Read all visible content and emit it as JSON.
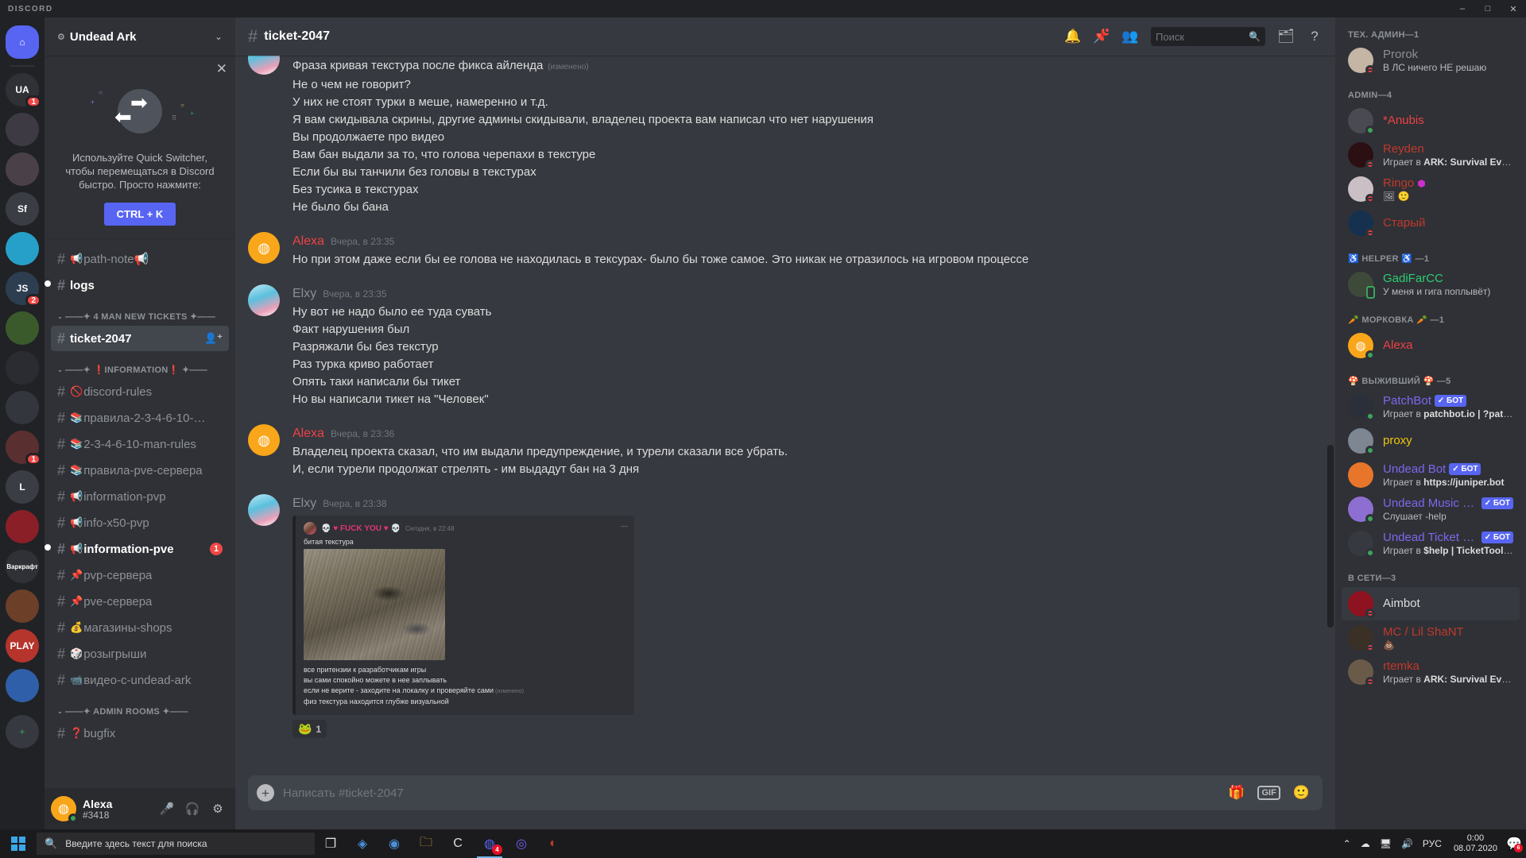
{
  "window": {
    "app_name": "DISCORD",
    "minimize": "–",
    "maximize": "□",
    "close": "✕"
  },
  "guild_rail": {
    "home_label": "⌂",
    "add_label": "+",
    "servers": [
      {
        "name": "UA",
        "badge": "1",
        "color": "#2f3136"
      },
      {
        "name": "",
        "badge": "",
        "color": "#3d3a44"
      },
      {
        "name": "",
        "badge": "",
        "color": "#4a4148"
      },
      {
        "name": "Sf",
        "badge": "",
        "color": "#3a3d44"
      },
      {
        "name": "",
        "badge": "",
        "color": "#27a0c9"
      },
      {
        "name": "JS",
        "badge": "2",
        "color": "#2c3e50"
      },
      {
        "name": "",
        "badge": "",
        "color": "#3a5a2c"
      },
      {
        "name": "",
        "badge": "",
        "color": "#2a2c31"
      },
      {
        "name": "",
        "badge": "",
        "color": "#33363c"
      },
      {
        "name": "",
        "badge": "1",
        "color": "#5a2f30"
      },
      {
        "name": "L",
        "badge": "",
        "color": "#3a3d44"
      },
      {
        "name": "",
        "badge": "",
        "color": "#8a1f28"
      },
      {
        "name": "Варкрафт",
        "badge": "",
        "color": "#2f3136"
      },
      {
        "name": "",
        "badge": "",
        "color": "#6b3f28"
      },
      {
        "name": "PLAY",
        "badge": "",
        "color": "#b5342c"
      },
      {
        "name": "",
        "badge": "",
        "color": "#2f5fa8"
      }
    ]
  },
  "sidebar": {
    "guild_name": "Undead Ark",
    "guild_icon": "gear-icon",
    "chevron": "⌄",
    "promo": {
      "close": "✕",
      "text": "Используйте Quick Switcher, чтобы перемещаться в Discord быстро. Просто нажмите:",
      "shortcut": "CTRL + K"
    },
    "groups": [
      {
        "label": "",
        "channels": [
          {
            "emoji": "📢",
            "name": "path-note📢",
            "state": "normal",
            "pill": false
          },
          {
            "emoji": "",
            "name": "logs",
            "state": "unread",
            "pill": true
          }
        ]
      },
      {
        "label": "——✦ 4 MAN NEW TICKETS ✦——",
        "channels": [
          {
            "emoji": "",
            "name": "ticket-2047",
            "state": "active",
            "pill": false,
            "locked": true,
            "add_member": true
          }
        ]
      },
      {
        "label": "——✦ ❗INFORMATION❗ ✦——",
        "channels": [
          {
            "emoji": "🚫",
            "name": "discord-rules",
            "state": "normal",
            "pill": false
          },
          {
            "emoji": "📚",
            "name": "правила-2-3-4-6-10-…",
            "state": "normal",
            "pill": false
          },
          {
            "emoji": "📚",
            "name": "2-3-4-6-10-man-rules",
            "state": "normal",
            "pill": false
          },
          {
            "emoji": "📚",
            "name": "правила-pve-сервера",
            "state": "normal",
            "pill": false
          },
          {
            "emoji": "📢",
            "name": "information-pvp",
            "state": "normal",
            "pill": false
          },
          {
            "emoji": "📢",
            "name": "info-x50-pvp",
            "state": "normal",
            "pill": false
          },
          {
            "emoji": "📢",
            "name": "information-pve",
            "state": "unread",
            "pill": true,
            "badge": "1"
          },
          {
            "emoji": "📌",
            "name": "pvp-сервера",
            "state": "normal",
            "pill": false
          },
          {
            "emoji": "📌",
            "name": "pve-сервера",
            "state": "normal",
            "pill": false
          },
          {
            "emoji": "💰",
            "name": "магазины-shops",
            "state": "normal",
            "pill": false
          },
          {
            "emoji": "🎲",
            "name": "розыгрыши",
            "state": "normal",
            "pill": false
          },
          {
            "emoji": "📹",
            "name": "видео-c-undead-ark",
            "state": "normal",
            "pill": false
          }
        ]
      },
      {
        "label": "——✦ ADMIN ROOMS ✦——",
        "channels": [
          {
            "emoji": "❓",
            "name": "bugfix",
            "state": "normal",
            "pill": false
          }
        ]
      }
    ],
    "user": {
      "name": "Alexa",
      "tag": "#3418",
      "mic_icon": "microphone-icon",
      "headset_icon": "headset-icon",
      "settings_icon": "gear-icon"
    }
  },
  "channel_header": {
    "hash": "#",
    "title": "ticket-2047",
    "icons": [
      "bell-icon",
      "pin-icon",
      "members-icon",
      "inbox-icon",
      "help-icon"
    ],
    "search_placeholder": "Поиск"
  },
  "messages": [
    {
      "type": "continuation",
      "avatar_color": "#5bc0de",
      "lines": [
        {
          "text": "Фраза кривая текстура после фикса айленда",
          "edited": "(изменено)"
        },
        {
          "text": "Не о чем не говорит?"
        },
        {
          "text": "У них не стоят турки в меше, намеренно  и т.д."
        },
        {
          "text": "Я вам скидывала скрины, другие админы скидывали, владелец проекта вам написал что нет нарушения"
        },
        {
          "text": "Вы продолжаете про видео"
        },
        {
          "text": "Вам бан выдали за то, что голова черепахи в текстуре"
        },
        {
          "text": "Если бы вы танчили без головы в текстурах"
        },
        {
          "text": "Без тусика в текстурах"
        },
        {
          "text": "Не было бы бана"
        }
      ]
    },
    {
      "type": "message",
      "author": "Alexa",
      "author_color": "#ed4245",
      "timestamp": "Вчера, в 23:35",
      "avatar_type": "discord-orange",
      "lines": [
        {
          "text": "Но при этом даже если бы ее голова не находилась в тексурах- было бы тоже самое. Это никак не отразилось на игровом процессе"
        }
      ]
    },
    {
      "type": "message",
      "author": "Elxy",
      "author_color": "#8b8f95",
      "timestamp": "Вчера, в 23:35",
      "avatar_color": "#5bc0de",
      "lines": [
        {
          "text": "Ну вот не надо было ее туда сувать"
        },
        {
          "text": "Факт нарушения был"
        },
        {
          "text": "Разряжали бы  без текстур"
        },
        {
          "text": "Раз турка криво работает"
        },
        {
          "text": "Опять таки написали бы тикет"
        },
        {
          "text": "Но вы написали тикет на \"Человек\""
        }
      ]
    },
    {
      "type": "message",
      "author": "Alexa",
      "author_color": "#ed4245",
      "timestamp": "Вчера, в 23:36",
      "avatar_type": "discord-orange",
      "lines": [
        {
          "text": "Владелец проекта сказал, что им выдали предупреждение, и турели сказали все убрать."
        },
        {
          "text": "И, если турели продолжат стрелять - им выдадут бан на 3 дня"
        }
      ]
    },
    {
      "type": "message",
      "author": "Elxy",
      "author_color": "#8b8f95",
      "timestamp": "Вчера, в 23:38",
      "avatar_color": "#5bc0de",
      "embed": {
        "author": "💀 ♥ FUCK YOU ♥ 💀",
        "timestamp": "Сегодня, в 22:48",
        "caption": "битая текстура",
        "lines": [
          {
            "text": "все притензии к разработчикам игры"
          },
          {
            "text": "вы сами спокойно можете в нее заплывать"
          },
          {
            "text": "если не верите - заходите на локалку и проверяйте сами",
            "edited": "(изменено)"
          },
          {
            "text": "физ текстура находится глубже визуальной"
          }
        ]
      },
      "reactions": [
        {
          "emoji": "🐸",
          "count": "1"
        }
      ]
    }
  ],
  "composer": {
    "placeholder": "Написать #ticket-2047",
    "plus": "+",
    "gift_icon": "gift-icon",
    "gif_label": "GIF",
    "emoji_icon": "emoji-icon"
  },
  "member_list": {
    "groups": [
      {
        "label": "ТЕХ. АДМИН—1",
        "members": [
          {
            "name": "Prorok",
            "color": "#8b8f95",
            "status": "dnd",
            "sub": "В ЛС ничего НЕ решаю",
            "avatar_color": "#c4b5a5"
          }
        ]
      },
      {
        "label": "ADMIN—4",
        "members": [
          {
            "name": "*Anubis",
            "color": "#ed4245",
            "status": "online",
            "sub": "",
            "avatar_color": "#4a4a52"
          },
          {
            "name": "Reyden",
            "color": "#c0392b",
            "status": "dnd",
            "sub": "Играет в ARK: Survival Evolved",
            "sub_bold": "ARK: Survival Evolved",
            "avatar_color": "#2b0f12"
          },
          {
            "name": "Ringo",
            "color": "#c0392b",
            "status": "dnd",
            "sub": "🖼 🙂",
            "avatar_color": "#c9bfc4",
            "name_suffix": "⬢"
          },
          {
            "name": "Старый",
            "color": "#c0392b",
            "status": "dnd",
            "sub": "",
            "avatar_color": "#15314f"
          }
        ]
      },
      {
        "label": "♿ HELPER ♿ —1",
        "members": [
          {
            "name": "GadiFarCC",
            "color": "#2ecc71",
            "status": "mobile",
            "sub": "У меня и гига поплывёт)",
            "avatar_color": "#3d4a3a"
          }
        ]
      },
      {
        "label": "🥕 МОРКОВКА 🥕 —1",
        "members": [
          {
            "name": "Alexa",
            "color": "#ed4245",
            "status": "online",
            "sub": "",
            "avatar_type": "discord-orange"
          }
        ]
      },
      {
        "label": "🍄 ВЫЖИВШИЙ 🍄 —5",
        "members": [
          {
            "name": "PatchBot",
            "color": "#7b68ee",
            "status": "online",
            "bot": "БОТ",
            "sub": "Играет в patchbot.io | ?patch…",
            "sub_bold": "patchbot.io | ?patch…",
            "avatar_color": "#2b2f3a"
          },
          {
            "name": "proxy",
            "color": "#f1c40f",
            "status": "online",
            "sub": "",
            "avatar_color": "#7d8691"
          },
          {
            "name": "Undead Bot",
            "color": "#7b68ee",
            "status": "",
            "bot": "БОТ",
            "sub": "Играет в https://juniper.bot",
            "sub_bold": "https://juniper.bot",
            "avatar_color": "#e8762a"
          },
          {
            "name": "Undead Music B…",
            "color": "#7b68ee",
            "status": "online",
            "bot": "БОТ",
            "sub": "Слушает -help",
            "avatar_color": "#8d6fd1"
          },
          {
            "name": "Undead Ticket B…",
            "color": "#7b68ee",
            "status": "online",
            "bot": "БОТ",
            "sub": "Играет в $help | TicketTool.xy…",
            "sub_bold": "$help | TicketTool.xy…",
            "avatar_color": "#36393f"
          }
        ]
      },
      {
        "label": "В СЕТИ—3",
        "members": [
          {
            "name": "Aimbot",
            "color": "#dcddde",
            "status": "dnd",
            "sub": "",
            "avatar_color": "#8e1220",
            "hover": true
          },
          {
            "name": "MC / Lil ShaNT",
            "color": "#c0392b",
            "status": "dnd",
            "sub": "💩",
            "avatar_color": "#3a3026"
          },
          {
            "name": "rtemka",
            "color": "#c0392b",
            "status": "dnd",
            "sub": "Играет в ARK: Survival Evolved",
            "sub_bold": "ARK: Survival Evolved",
            "avatar_color": "#6a5a4a"
          }
        ]
      }
    ]
  },
  "taskbar": {
    "search_placeholder": "Введите здесь текст для поиска",
    "apps": [
      {
        "name": "task-view-icon",
        "glyph": "❐",
        "active": false,
        "badge": ""
      },
      {
        "name": "app-blue-icon",
        "glyph": "◈",
        "active": false,
        "badge": "",
        "color": "#4a90d9"
      },
      {
        "name": "chrome-icon",
        "glyph": "◉",
        "active": false,
        "badge": "",
        "color": "#4a90d9"
      },
      {
        "name": "explorer-icon",
        "glyph": "🗀",
        "active": false,
        "badge": "",
        "color": "#f0b23c"
      },
      {
        "name": "app-c-icon",
        "glyph": "C",
        "active": false,
        "badge": "",
        "color": "#dcddde"
      },
      {
        "name": "discord-icon",
        "glyph": "◍",
        "active": true,
        "badge": "4",
        "color": "#5865f2"
      },
      {
        "name": "viber-icon",
        "glyph": "◎",
        "active": false,
        "badge": "",
        "color": "#7360f2"
      },
      {
        "name": "app-red-icon",
        "glyph": "◐",
        "active": false,
        "badge": "",
        "color": "#c0392b"
      }
    ],
    "tray": {
      "chevron": "⌃",
      "cloud_icon": "cloud-icon",
      "monitor_icon": "monitor-icon",
      "volume_icon": "volume-icon",
      "language": "РУС",
      "time": "0:00",
      "date": "08.07.2020",
      "notification_count": "6"
    }
  }
}
